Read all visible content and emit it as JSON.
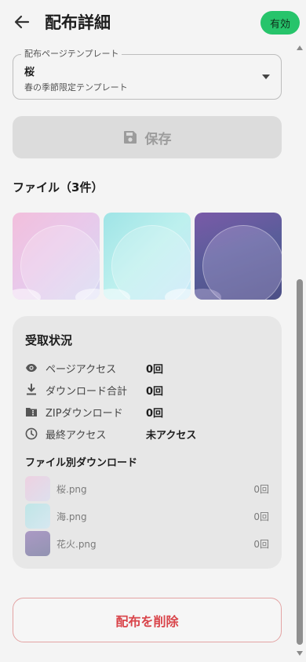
{
  "header": {
    "title": "配布詳細",
    "status_badge": "有効",
    "back_icon": "arrow-left-icon"
  },
  "template_select": {
    "legend": "配布ページテンプレート",
    "value": "桜",
    "description": "春の季節限定テンプレート"
  },
  "save_button": {
    "label": "保存",
    "icon": "floppy-disk-icon",
    "disabled": true
  },
  "files": {
    "heading": "ファイル（3件）",
    "items": [
      {
        "name": "桜.png"
      },
      {
        "name": "海.png"
      },
      {
        "name": "花火.png"
      }
    ]
  },
  "stats": {
    "title": "受取状況",
    "rows": [
      {
        "label": "ページアクセス",
        "value": "0回",
        "icon": "eye-icon"
      },
      {
        "label": "ダウンロード合計",
        "value": "0回",
        "icon": "download-icon"
      },
      {
        "label": "ZIPダウンロード",
        "value": "0回",
        "icon": "zip-folder-icon"
      },
      {
        "label": "最終アクセス",
        "value": "未アクセス",
        "icon": "clock-icon"
      }
    ],
    "per_file_heading": "ファイル別ダウンロード",
    "per_file": [
      {
        "name": "桜.png",
        "count": "0回"
      },
      {
        "name": "海.png",
        "count": "0回"
      },
      {
        "name": "花火.png",
        "count": "0回"
      }
    ]
  },
  "delete_button": {
    "label": "配布を削除"
  },
  "colors": {
    "accent_green": "#27c46b",
    "danger_red": "#d9454b",
    "card_bg": "#e7e7e7",
    "page_bg": "#f4f4f4"
  }
}
